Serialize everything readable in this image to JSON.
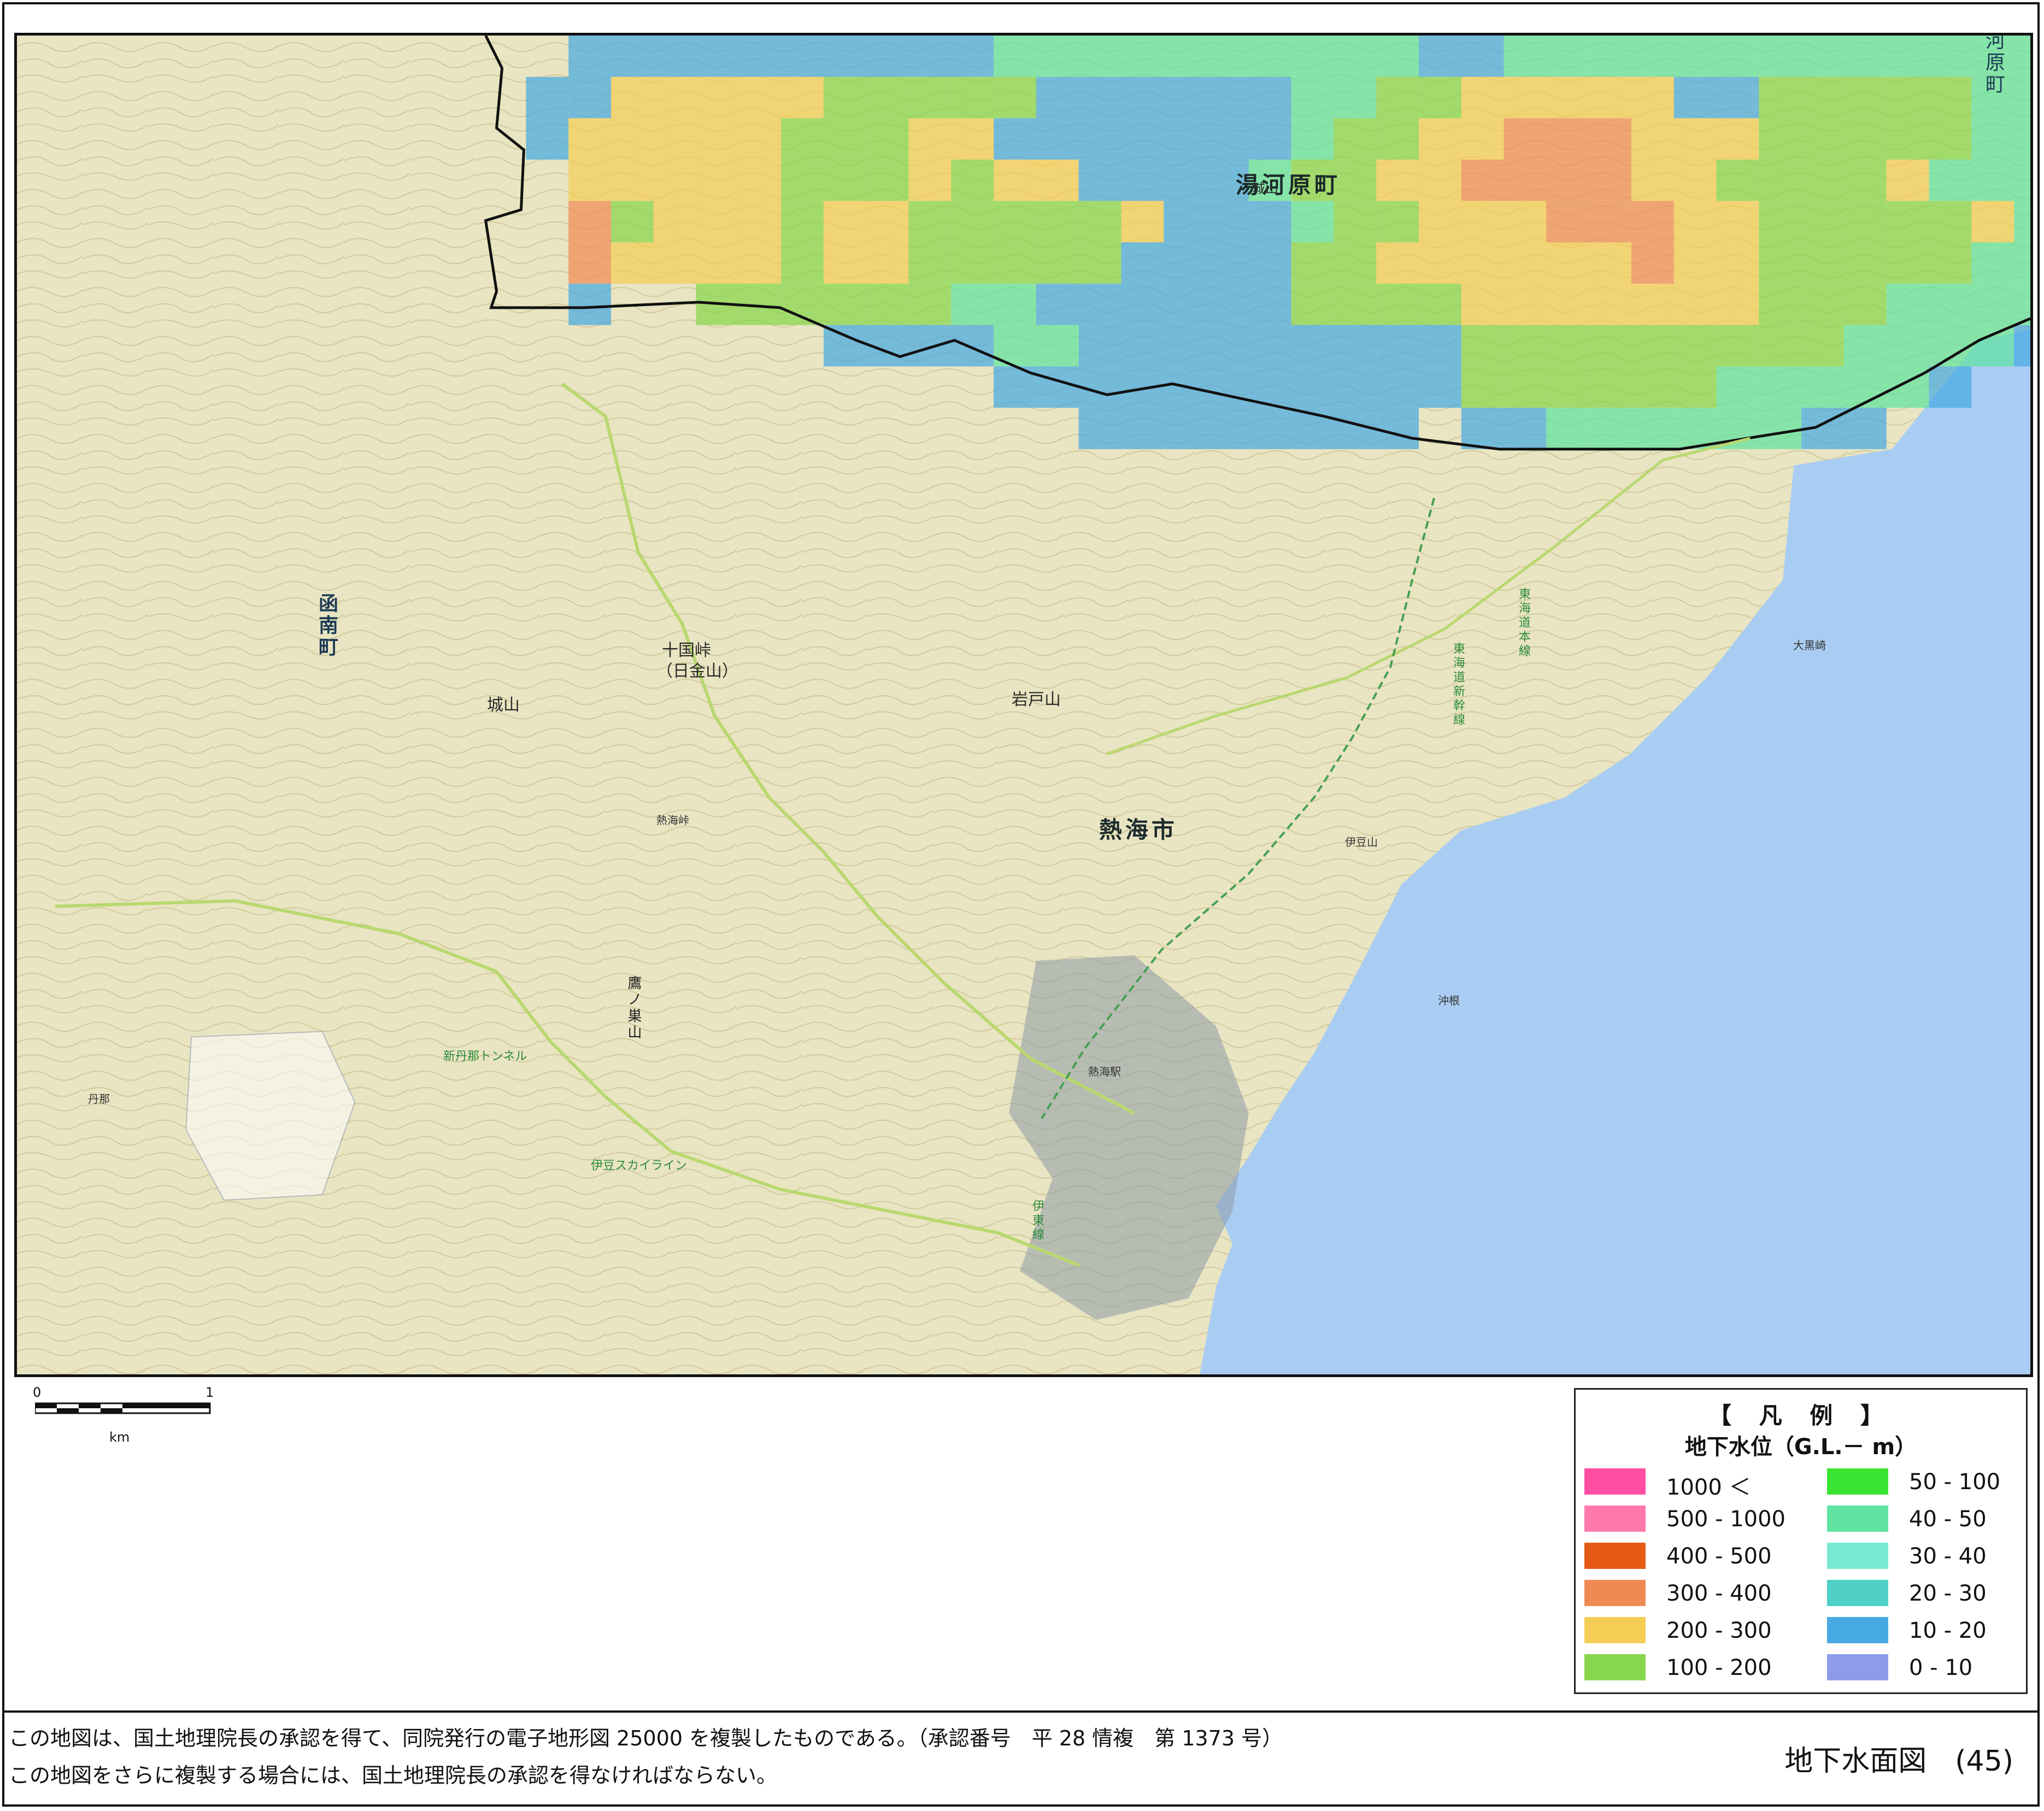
{
  "map": {
    "town_labels": {
      "yugawara": "湯河原町",
      "atami": "熱海市",
      "kannami_v": "函南町",
      "yugawara_edge_v": "河原町"
    },
    "mountain_labels": {
      "jikkoku": "十国峠",
      "hikane": "（日金山）",
      "shiroyama_n": "城山",
      "shiroyama_w": "城山",
      "iwatoyama": "岩戸山",
      "kurodake": "鷹ノ巣山"
    },
    "place_labels": {
      "okinohama": "沖根",
      "oshima": "大黒崎",
      "atami_st": "熱海駅",
      "tanna": "丹那",
      "sea_label": "伊豆山"
    },
    "rail_labels": {
      "tokaido": "東海道新幹線",
      "tokaido_main": "東海道本線",
      "ito": "伊東線",
      "tanna_tunnel": "新丹那トンネル"
    },
    "road_labels": {
      "izu_skyline": "伊豆スカイライン",
      "atami_pass": "熱海峠"
    },
    "colors": {
      "terrain": "#e9e4c2",
      "terrain_dark": "#d6d19f",
      "sea": "#a9cdf2",
      "contour": "#b9b07a",
      "road": "#b9d870",
      "city": "#8e9aa8",
      "boundary": "#111111"
    }
  },
  "scale": {
    "tick_start": "0",
    "tick_end": "1",
    "unit": "km"
  },
  "legend": {
    "title": "【 凡 例 】",
    "subtitle": "地下水位（G.L.－ m）",
    "items": [
      {
        "label": "1000 ＜",
        "color": "#ff4fa2"
      },
      {
        "label": "500 - 1000",
        "color": "#ff79ad"
      },
      {
        "label": "400 - 500",
        "color": "#e55a15"
      },
      {
        "label": "300 - 400",
        "color": "#f08a55"
      },
      {
        "label": "200 - 300",
        "color": "#f4cd55"
      },
      {
        "label": "100 - 200",
        "color": "#88d64b"
      },
      {
        "label": "50 - 100",
        "color": "#3ae432"
      },
      {
        "label": "40 - 50",
        "color": "#5fe3a0"
      },
      {
        "label": "30 - 40",
        "color": "#78e8d3"
      },
      {
        "label": "20 - 30",
        "color": "#4fd1c8"
      },
      {
        "label": "10 - 20",
        "color": "#47a9e2"
      },
      {
        "label": "0 - 10",
        "color": "#8c9ce9"
      }
    ]
  },
  "footer": {
    "note1": "この地図は、国土地理院長の承認を得て、同院発行の電子地形図 25000 を複製したものである。（承認番号　平 28 情複　第 1373 号）",
    "note2": "この地図をさらに複製する場合には、国土地理院長の承認を得なければならない。",
    "sheet_title": "地下水面図　(45)"
  }
}
